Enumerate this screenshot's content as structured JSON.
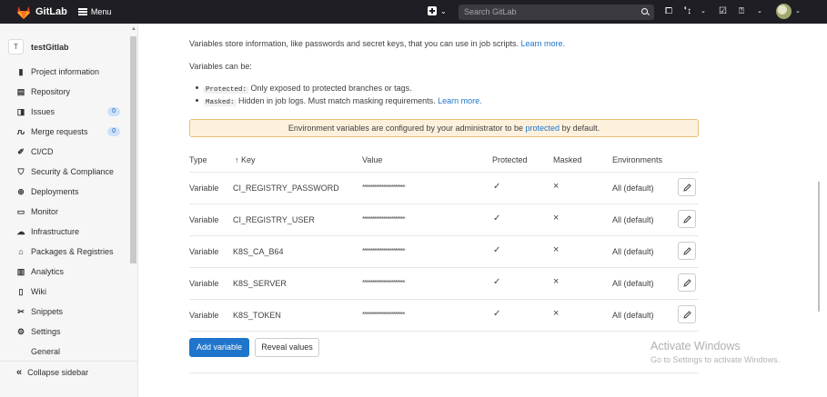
{
  "topbar": {
    "app_name": "GitLab",
    "menu_label": "Menu",
    "search_placeholder": "Search GitLab"
  },
  "sidebar": {
    "project_avatar": "T",
    "project_name": "testGitlab",
    "items": [
      {
        "label": "Project information",
        "icon": "info-icon"
      },
      {
        "label": "Repository",
        "icon": "book-icon"
      },
      {
        "label": "Issues",
        "icon": "issues-icon",
        "badge": "0"
      },
      {
        "label": "Merge requests",
        "icon": "merge-request-icon",
        "badge": "0"
      },
      {
        "label": "CI/CD",
        "icon": "rocket-icon"
      },
      {
        "label": "Security & Compliance",
        "icon": "shield-icon"
      },
      {
        "label": "Deployments",
        "icon": "deployments-icon"
      },
      {
        "label": "Monitor",
        "icon": "monitor-icon"
      },
      {
        "label": "Infrastructure",
        "icon": "cloud-icon"
      },
      {
        "label": "Packages & Registries",
        "icon": "package-icon"
      },
      {
        "label": "Analytics",
        "icon": "chart-icon"
      },
      {
        "label": "Wiki",
        "icon": "book-open-icon"
      },
      {
        "label": "Snippets",
        "icon": "scissors-icon"
      },
      {
        "label": "Settings",
        "icon": "gear-icon"
      },
      {
        "label": "General",
        "icon": ""
      }
    ],
    "collapse_label": "Collapse sidebar"
  },
  "main": {
    "intro_text": "Variables store information, like passwords and secret keys, that you can use in job scripts.",
    "intro_link": "Learn more.",
    "can_be": "Variables can be:",
    "bullet1_code": "Protected:",
    "bullet1_text": "Only exposed to protected branches or tags.",
    "bullet2_code": "Masked:",
    "bullet2_text": "Hidden in job logs. Must match masking requirements.",
    "bullet2_link": "Learn more.",
    "alert_pre": "Environment variables are configured by your administrator to be",
    "alert_link": "protected",
    "alert_post": "by default.",
    "columns": {
      "type": "Type",
      "key": "↑ Key",
      "value": "Value",
      "protected": "Protected",
      "masked": "Masked",
      "environments": "Environments"
    },
    "rows": [
      {
        "type": "Variable",
        "key": "CI_REGISTRY_PASSWORD",
        "value": "**********************",
        "protected": "✓",
        "masked": "×",
        "env": "All (default)"
      },
      {
        "type": "Variable",
        "key": "CI_REGISTRY_USER",
        "value": "**********************",
        "protected": "✓",
        "masked": "×",
        "env": "All (default)"
      },
      {
        "type": "Variable",
        "key": "K8S_CA_B64",
        "value": "**********************",
        "protected": "✓",
        "masked": "×",
        "env": "All (default)"
      },
      {
        "type": "Variable",
        "key": "K8S_SERVER",
        "value": "**********************",
        "protected": "✓",
        "masked": "×",
        "env": "All (default)"
      },
      {
        "type": "Variable",
        "key": "K8S_TOKEN",
        "value": "**********************",
        "protected": "✓",
        "masked": "×",
        "env": "All (default)"
      }
    ],
    "add_button": "Add variable",
    "reveal_button": "Reveal values"
  },
  "watermark": {
    "line1": "Activate Windows",
    "line2": "Go to Settings to activate Windows."
  },
  "colors": {
    "topbar": "#1f1e24",
    "primary": "#1f75cb",
    "alert_bg": "#fdf1dd",
    "alert_border": "#e9be74"
  }
}
